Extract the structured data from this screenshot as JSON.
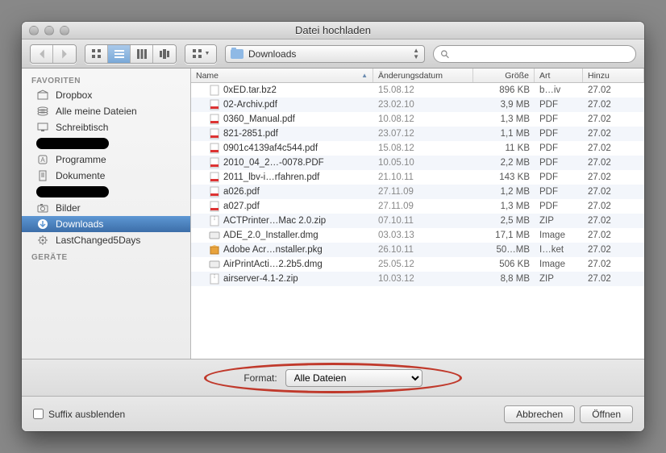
{
  "window": {
    "title": "Datei hochladen"
  },
  "toolbar": {
    "location": "Downloads",
    "search_placeholder": ""
  },
  "sidebar": {
    "favorites_header": "FAVORITEN",
    "devices_header": "GERÄTE",
    "items": [
      {
        "label": "Dropbox",
        "icon": "box"
      },
      {
        "label": "Alle meine Dateien",
        "icon": "stack"
      },
      {
        "label": "Schreibtisch",
        "icon": "desktop"
      },
      {
        "label": "",
        "icon": "redact"
      },
      {
        "label": "Programme",
        "icon": "app"
      },
      {
        "label": "Dokumente",
        "icon": "doc"
      },
      {
        "label": "",
        "icon": "redact"
      },
      {
        "label": "Bilder",
        "icon": "camera"
      },
      {
        "label": "Downloads",
        "icon": "download",
        "selected": true
      },
      {
        "label": "LastChanged5Days",
        "icon": "gear"
      }
    ]
  },
  "columns": {
    "name": "Name",
    "date": "Änderungsdatum",
    "size": "Größe",
    "kind": "Art",
    "added": "Hinzu"
  },
  "files": [
    {
      "name": "0xED.tar.bz2",
      "date": "15.08.12",
      "size": "896 KB",
      "kind": "b…iv",
      "added": "27.02",
      "icon": "archive"
    },
    {
      "name": "02-Archiv.pdf",
      "date": "23.02.10",
      "size": "3,9 MB",
      "kind": "PDF",
      "added": "27.02",
      "icon": "pdf"
    },
    {
      "name": "0360_Manual.pdf",
      "date": "10.08.12",
      "size": "1,3 MB",
      "kind": "PDF",
      "added": "27.02",
      "icon": "pdf"
    },
    {
      "name": "821-2851.pdf",
      "date": "23.07.12",
      "size": "1,1 MB",
      "kind": "PDF",
      "added": "27.02",
      "icon": "pdf"
    },
    {
      "name": "0901c4139af4c544.pdf",
      "date": "15.08.12",
      "size": "11 KB",
      "kind": "PDF",
      "added": "27.02",
      "icon": "pdf"
    },
    {
      "name": "2010_04_2…-0078.PDF",
      "date": "10.05.10",
      "size": "2,2 MB",
      "kind": "PDF",
      "added": "27.02",
      "icon": "pdf"
    },
    {
      "name": "2011_lbv-i…rfahren.pdf",
      "date": "21.10.11",
      "size": "143 KB",
      "kind": "PDF",
      "added": "27.02",
      "icon": "pdf"
    },
    {
      "name": "a026.pdf",
      "date": "27.11.09",
      "size": "1,2 MB",
      "kind": "PDF",
      "added": "27.02",
      "icon": "pdf"
    },
    {
      "name": "a027.pdf",
      "date": "27.11.09",
      "size": "1,3 MB",
      "kind": "PDF",
      "added": "27.02",
      "icon": "pdf"
    },
    {
      "name": "ACTPrinter…Mac 2.0.zip",
      "date": "07.10.11",
      "size": "2,5 MB",
      "kind": "ZIP",
      "added": "27.02",
      "icon": "zip"
    },
    {
      "name": "ADE_2.0_Installer.dmg",
      "date": "03.03.13",
      "size": "17,1 MB",
      "kind": "Image",
      "added": "27.02",
      "icon": "dmg"
    },
    {
      "name": "Adobe Acr…nstaller.pkg",
      "date": "26.10.11",
      "size": "50…MB",
      "kind": "I…ket",
      "added": "27.02",
      "icon": "pkg"
    },
    {
      "name": "AirPrintActi…2.2b5.dmg",
      "date": "25.05.12",
      "size": "506 KB",
      "kind": "Image",
      "added": "27.02",
      "icon": "dmg"
    },
    {
      "name": "airserver-4.1-2.zip",
      "date": "10.03.12",
      "size": "8,8 MB",
      "kind": "ZIP",
      "added": "27.02",
      "icon": "zip"
    }
  ],
  "format": {
    "label": "Format:",
    "value": "Alle Dateien"
  },
  "footer": {
    "suffix": "Suffix ausblenden",
    "cancel": "Abbrechen",
    "open": "Öffnen"
  }
}
